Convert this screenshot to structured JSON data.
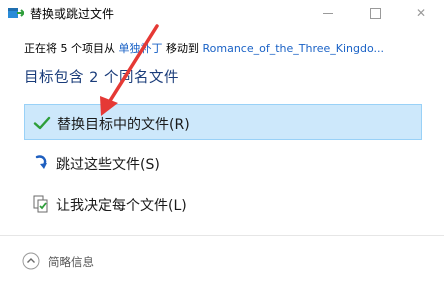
{
  "window": {
    "title": "替换或跳过文件",
    "app_icon": "folder-move-icon",
    "controls": {
      "minimize": "minimize-icon",
      "maximize": "maximize-icon",
      "close": "✕"
    }
  },
  "info_line": {
    "prefix": "正在将 5 个项目从 ",
    "source": "单独补丁",
    "middle": " 移动到 ",
    "destination": "Romance_of_the_Three_Kingdo..."
  },
  "heading": "目标包含 2 个同名文件",
  "options": [
    {
      "label": "替换目标中的文件(R)",
      "icon": "checkmark-icon",
      "selected": true
    },
    {
      "label": "跳过这些文件(S)",
      "icon": "skip-arrow-icon",
      "selected": false
    },
    {
      "label": "让我决定每个文件(L)",
      "icon": "decide-files-icon",
      "selected": false
    }
  ],
  "footer": {
    "label": "简略信息",
    "icon": "chevron-up-icon"
  },
  "colors": {
    "accent": "#1a62c6",
    "selected_bg": "#cde8fb",
    "heading": "#1a3c7a",
    "annotation_arrow": "#e53935"
  }
}
